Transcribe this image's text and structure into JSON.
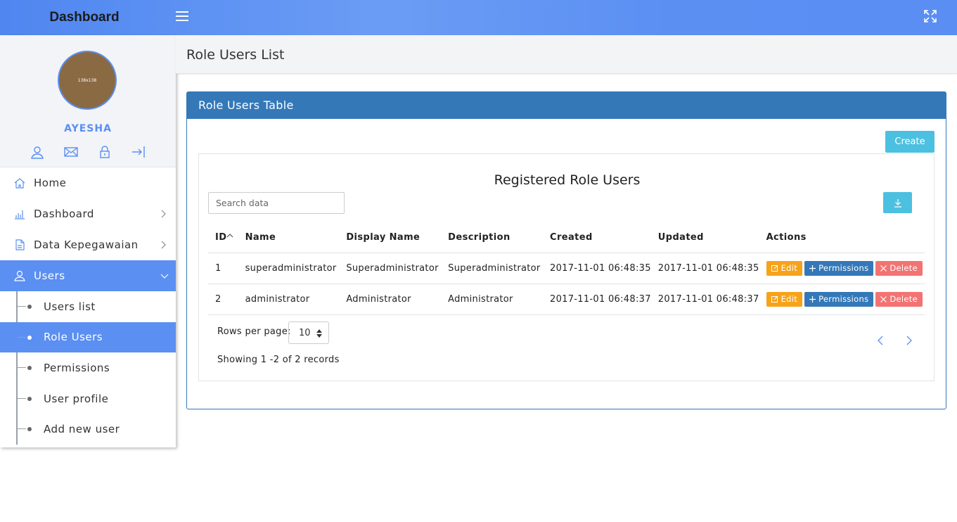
{
  "header": {
    "brand": "Dashboard"
  },
  "profile": {
    "avatar_text": "138x138",
    "name": "AYESHA"
  },
  "sidebar": {
    "items": [
      {
        "label": "Home"
      },
      {
        "label": "Dashboard"
      },
      {
        "label": "Data Kepegawaian"
      },
      {
        "label": "Users"
      }
    ],
    "users_sub": [
      {
        "label": "Users list"
      },
      {
        "label": "Role Users"
      },
      {
        "label": "Permissions"
      },
      {
        "label": "User profile"
      },
      {
        "label": "Add new user"
      }
    ]
  },
  "page": {
    "title": "Role Users List"
  },
  "panel": {
    "title": "Role Users Table",
    "create_label": "Create",
    "table_title": "Registered Role Users",
    "search_placeholder": "Search data"
  },
  "table": {
    "headers": [
      "ID",
      "Name",
      "Display Name",
      "Description",
      "Created",
      "Updated",
      "Actions"
    ],
    "rows": [
      [
        "1",
        "superadministrator",
        "Superadministrator",
        "Superadministrator",
        "2017-11-01 06:48:35",
        "2017-11-01 06:48:35"
      ],
      [
        "2",
        "administrator",
        "Administrator",
        "Administrator",
        "2017-11-01 06:48:37",
        "2017-11-01 06:48:37"
      ]
    ],
    "actions": {
      "edit": "Edit",
      "permissions": "Permissions",
      "delete": "Delete"
    }
  },
  "footer": {
    "rows_per_page_label": "Rows per page:",
    "rows_per_page_value": "10",
    "showing": "Showing 1 -2 of 2 records"
  },
  "colors": {
    "accent": "#5b8ff2",
    "panel_blue": "#3478b8",
    "info": "#4cc0e0",
    "warning": "#f7a31a",
    "danger": "#f37373"
  }
}
